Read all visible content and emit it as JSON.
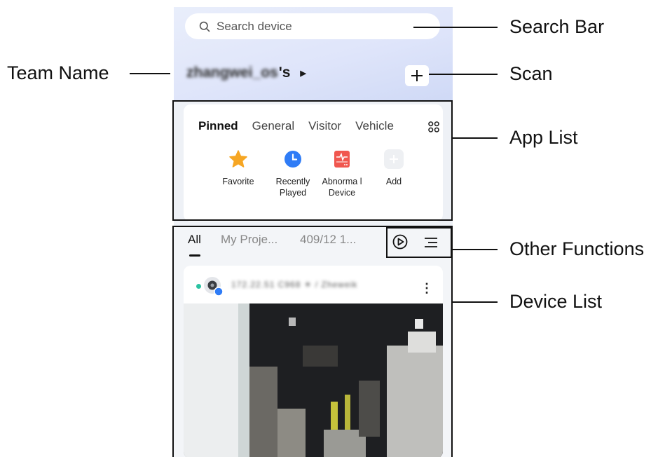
{
  "search": {
    "placeholder": "Search device"
  },
  "team": {
    "name": "zhangwei_os",
    "suffix": "'s"
  },
  "app_tabs": [
    "Pinned",
    "General",
    "Visitor",
    "Vehicle"
  ],
  "apps": [
    {
      "label": "Favorite",
      "icon": "star-icon"
    },
    {
      "label": "Recently Played",
      "icon": "clock-icon"
    },
    {
      "label": "Abnorma l Device",
      "icon": "abnormal-device-icon"
    },
    {
      "label": "Add",
      "icon": "add-icon"
    }
  ],
  "device_tabs": [
    "All",
    "My Proje...",
    "409/12 1..."
  ],
  "device": {
    "name": "172.22.51 C968 ☀ / Zheweik",
    "status": "online"
  },
  "annotations": {
    "search_bar": "Search Bar",
    "team_name": "Team Name",
    "scan": "Scan",
    "app_list": "App List",
    "other_functions": "Other Functions",
    "device_list": "Device List"
  },
  "colors": {
    "online": "#2bc3a2",
    "favorite": "#f6a623",
    "recent": "#2f7cf6",
    "abnormal": "#f0574f"
  }
}
